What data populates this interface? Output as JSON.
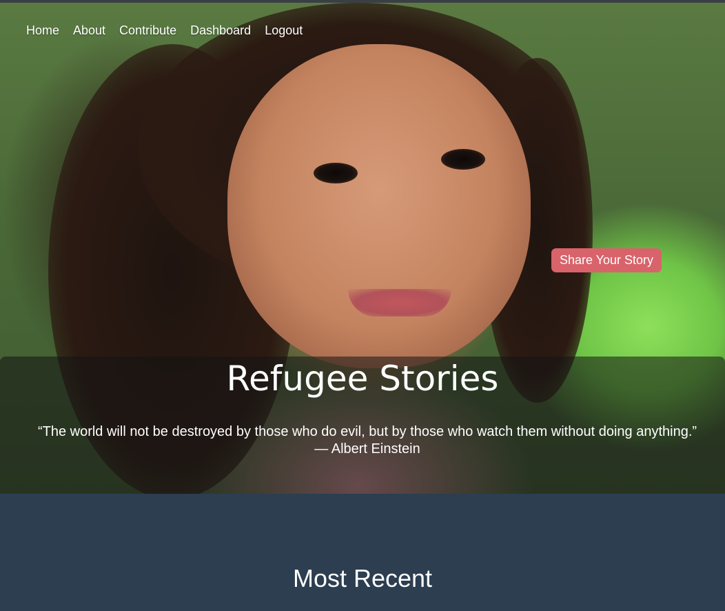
{
  "nav": {
    "items": [
      {
        "label": "Home"
      },
      {
        "label": "About"
      },
      {
        "label": "Contribute"
      },
      {
        "label": "Dashboard"
      },
      {
        "label": "Logout"
      }
    ]
  },
  "hero": {
    "share_button_label": "Share Your Story",
    "title": "Refugee Stories",
    "quote": "“The world will not be destroyed by those who do evil, but by those who watch them without doing anything.” — Albert Einstein"
  },
  "section": {
    "title": "Most Recent"
  },
  "colors": {
    "accent": "#d8636a",
    "background": "#2c3e50"
  }
}
